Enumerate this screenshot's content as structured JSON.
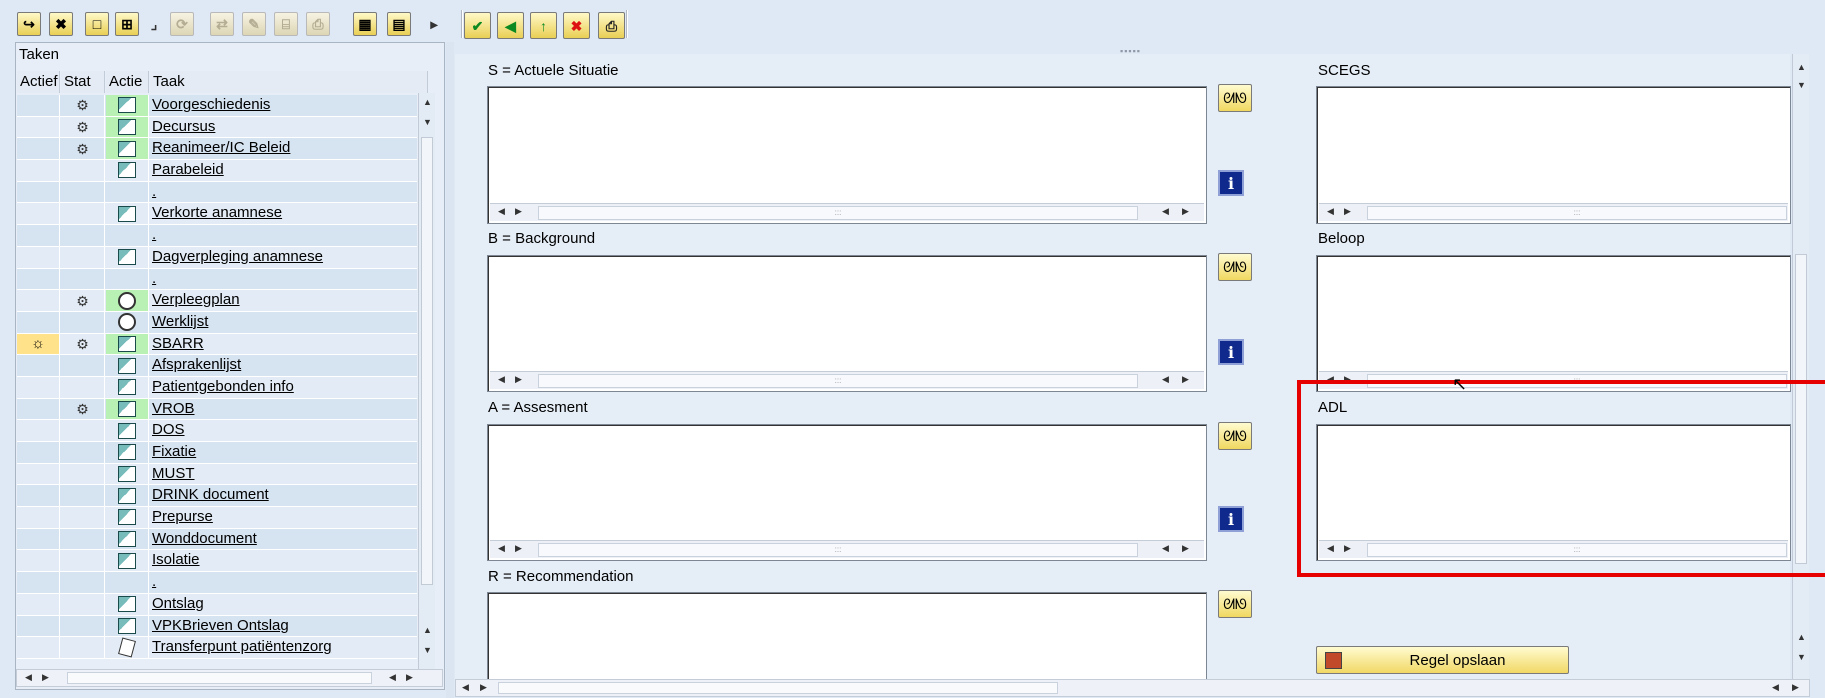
{
  "toolbar_left": {
    "buttons": [
      "doc-arrow-icon",
      "delete-doc-icon",
      "blank-page-icon",
      "grid-star-icon",
      "dropdown-arrow-icon",
      "refresh-icon",
      "transfer-icon",
      "edit-icon",
      "folder-open-icon",
      "print-preview-icon",
      "table-icon",
      "layout-icon",
      "more-icon"
    ]
  },
  "toolbar_right": {
    "buttons": [
      {
        "name": "check-icon",
        "glyph": "✔"
      },
      {
        "name": "back-icon",
        "glyph": "◀"
      },
      {
        "name": "exit-icon",
        "glyph": "↑"
      },
      {
        "name": "cancel-icon",
        "glyph": "✖"
      },
      {
        "name": "print-icon",
        "glyph": "⎙"
      }
    ]
  },
  "taken": {
    "title": "Taken",
    "columns": {
      "actief": "Actief",
      "stat": "Stat",
      "actie": "Actie",
      "taak": "Taak"
    },
    "rows": [
      {
        "taak": "Voorgeschiedenis",
        "stat": true,
        "actie": "doc",
        "green": true
      },
      {
        "taak": "Decursus",
        "stat": true,
        "actie": "doc",
        "green": true
      },
      {
        "taak": "Reanimeer/IC Beleid",
        "stat": true,
        "actie": "doc",
        "green": true
      },
      {
        "taak": "Parabeleid",
        "stat": false,
        "actie": "doc",
        "green": false
      },
      {
        "taak": ".",
        "stat": false,
        "actie": "",
        "green": false
      },
      {
        "taak": "Verkorte anamnese",
        "stat": false,
        "actie": "doc",
        "green": false
      },
      {
        "taak": ".",
        "stat": false,
        "actie": "",
        "green": false
      },
      {
        "taak": "Dagverpleging anamnese",
        "stat": false,
        "actie": "doc",
        "green": false
      },
      {
        "taak": ".",
        "stat": false,
        "actie": "",
        "green": false
      },
      {
        "taak": "Verpleegplan",
        "stat": true,
        "actie": "clock",
        "green": true
      },
      {
        "taak": "Werklijst",
        "stat": false,
        "actie": "clock",
        "green": false
      },
      {
        "taak": "SBARR",
        "stat": true,
        "actie": "doc",
        "green": true,
        "active": true
      },
      {
        "taak": "Afsprakenlijst",
        "stat": false,
        "actie": "doc",
        "green": false
      },
      {
        "taak": "Patientgebonden info",
        "stat": false,
        "actie": "doc",
        "green": false
      },
      {
        "taak": "VROB",
        "stat": true,
        "actie": "doc",
        "green": true
      },
      {
        "taak": "DOS",
        "stat": false,
        "actie": "doc",
        "green": false
      },
      {
        "taak": "Fixatie",
        "stat": false,
        "actie": "doc",
        "green": false
      },
      {
        "taak": "MUST",
        "stat": false,
        "actie": "doc",
        "green": false
      },
      {
        "taak": "DRINK document",
        "stat": false,
        "actie": "doc",
        "green": false
      },
      {
        "taak": "Prepurse",
        "stat": false,
        "actie": "doc",
        "green": false
      },
      {
        "taak": "Wonddocument",
        "stat": false,
        "actie": "doc",
        "green": false
      },
      {
        "taak": "Isolatie",
        "stat": false,
        "actie": "doc",
        "green": false
      },
      {
        "taak": ".",
        "stat": false,
        "actie": "",
        "green": false
      },
      {
        "taak": "Ontslag",
        "stat": false,
        "actie": "doc",
        "green": false
      },
      {
        "taak": "VPKBrieven Ontslag",
        "stat": false,
        "actie": "doc",
        "green": false
      },
      {
        "taak": "Transferpunt patiëntenzorg",
        "stat": false,
        "actie": "page",
        "green": false
      }
    ]
  },
  "sections": {
    "s_label": "S = Actuele Situatie",
    "b_label": "B = Background",
    "a_label": "A = Assesment",
    "r_label": "R = Recommendation",
    "scegs_label": "SCEGS",
    "beloop_label": "Beloop",
    "adl_label": "ADL"
  },
  "save_button": "Regel opslaan",
  "colors": {
    "highlight": "#e60000",
    "background": "#dfe9f5"
  }
}
